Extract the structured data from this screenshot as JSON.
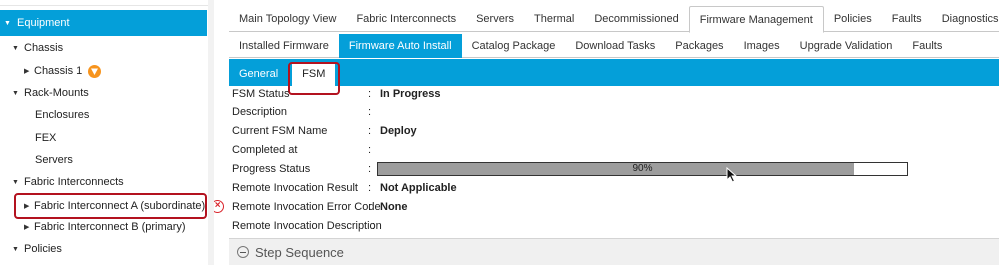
{
  "sidebar": {
    "selected": "Equipment",
    "items": [
      {
        "label": "Chassis"
      },
      {
        "label": "Chassis 1"
      },
      {
        "label": "Rack-Mounts"
      },
      {
        "label": "Enclosures"
      },
      {
        "label": "FEX"
      },
      {
        "label": "Servers"
      },
      {
        "label": "Fabric Interconnects"
      },
      {
        "label": "Fabric Interconnect A (subordinate)"
      },
      {
        "label": "Fabric Interconnect B (primary)"
      },
      {
        "label": "Policies"
      }
    ]
  },
  "tabs_top": [
    "Main Topology View",
    "Fabric Interconnects",
    "Servers",
    "Thermal",
    "Decommissioned",
    "Firmware Management",
    "Policies",
    "Faults",
    "Diagnostics"
  ],
  "tabs_firmware": [
    "Installed Firmware",
    "Firmware Auto Install",
    "Catalog Package",
    "Download Tasks",
    "Packages",
    "Images",
    "Upgrade Validation",
    "Faults"
  ],
  "tabs_sub": [
    "General",
    "FSM"
  ],
  "fsm": {
    "rows": [
      {
        "label": "FSM Status",
        "colon": ":",
        "value": "In Progress"
      },
      {
        "label": "Description",
        "colon": ":",
        "value": ""
      },
      {
        "label": "Current FSM Name",
        "colon": ":",
        "value": "Deploy"
      },
      {
        "label": "Completed at",
        "colon": ":",
        "value": ""
      },
      {
        "label": "Progress Status",
        "colon": ":",
        "value": ""
      },
      {
        "label": "Remote Invocation Result",
        "colon": ":",
        "value": "Not Applicable"
      },
      {
        "label": "Remote Invocation Error Code",
        "colon": ":",
        "value": "None"
      },
      {
        "label": "Remote Invocation Description",
        "colon": ":",
        "value": ""
      }
    ],
    "progress_text": "90%",
    "progress_fraction": 0.9
  },
  "step_sequence": "Step Sequence",
  "colors": {
    "accent": "#049fd9",
    "highlight": "#b3121f",
    "warning": "#f7941d",
    "error": "#d9232a"
  }
}
